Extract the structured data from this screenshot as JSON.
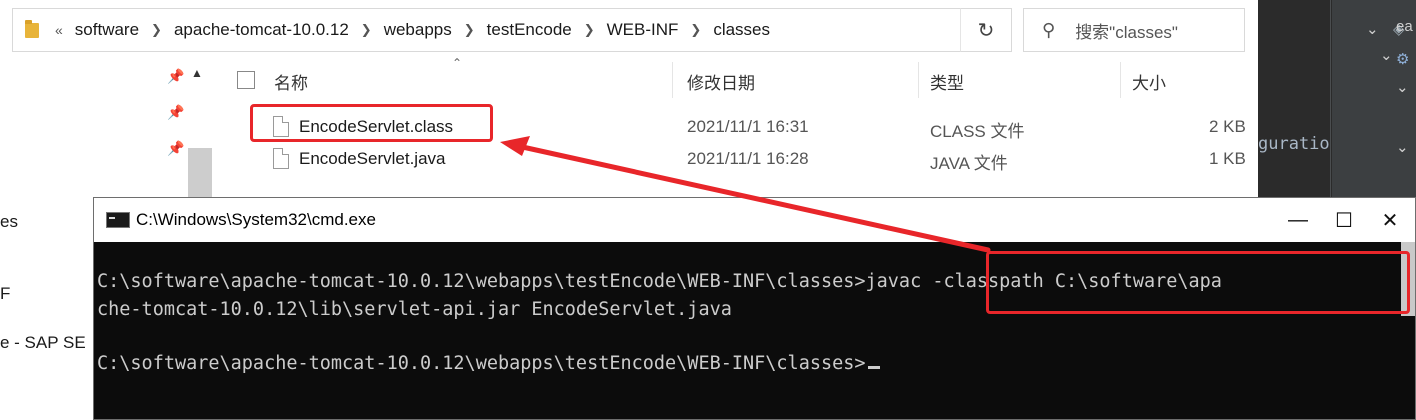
{
  "explorer": {
    "breadcrumb": [
      "software",
      "apache-tomcat-10.0.12",
      "webapps",
      "testEncode",
      "WEB-INF",
      "classes"
    ],
    "breadcrumb_overflow": "«",
    "search_placeholder": "搜索\"classes\"",
    "columns": {
      "name": "名称",
      "modified": "修改日期",
      "type": "类型",
      "size": "大小"
    },
    "files": [
      {
        "name": "EncodeServlet.class",
        "modified": "2021/11/1 16:31",
        "type": "CLASS 文件",
        "size": "2 KB"
      },
      {
        "name": "EncodeServlet.java",
        "modified": "2021/11/1 16:28",
        "type": "JAVA 文件",
        "size": "1 KB"
      }
    ]
  },
  "sidebar": {
    "items": [
      "es",
      "F",
      "e - SAP SE"
    ]
  },
  "ide": {
    "label_ea": "ea",
    "code_text": "guratio"
  },
  "cmd": {
    "title": "C:\\Windows\\System32\\cmd.exe",
    "lines": [
      "C:\\software\\apache-tomcat-10.0.12\\webapps\\testEncode\\WEB-INF\\classes>javac -classpath C:\\software\\apa",
      "che-tomcat-10.0.12\\lib\\servlet-api.jar EncodeServlet.java",
      "",
      "C:\\software\\apache-tomcat-10.0.12\\webapps\\testEncode\\WEB-INF\\classes>"
    ]
  },
  "colors": {
    "highlight": "#e8262a",
    "cmd_bg": "#0c0c0c",
    "cmd_text": "#cccccc"
  }
}
